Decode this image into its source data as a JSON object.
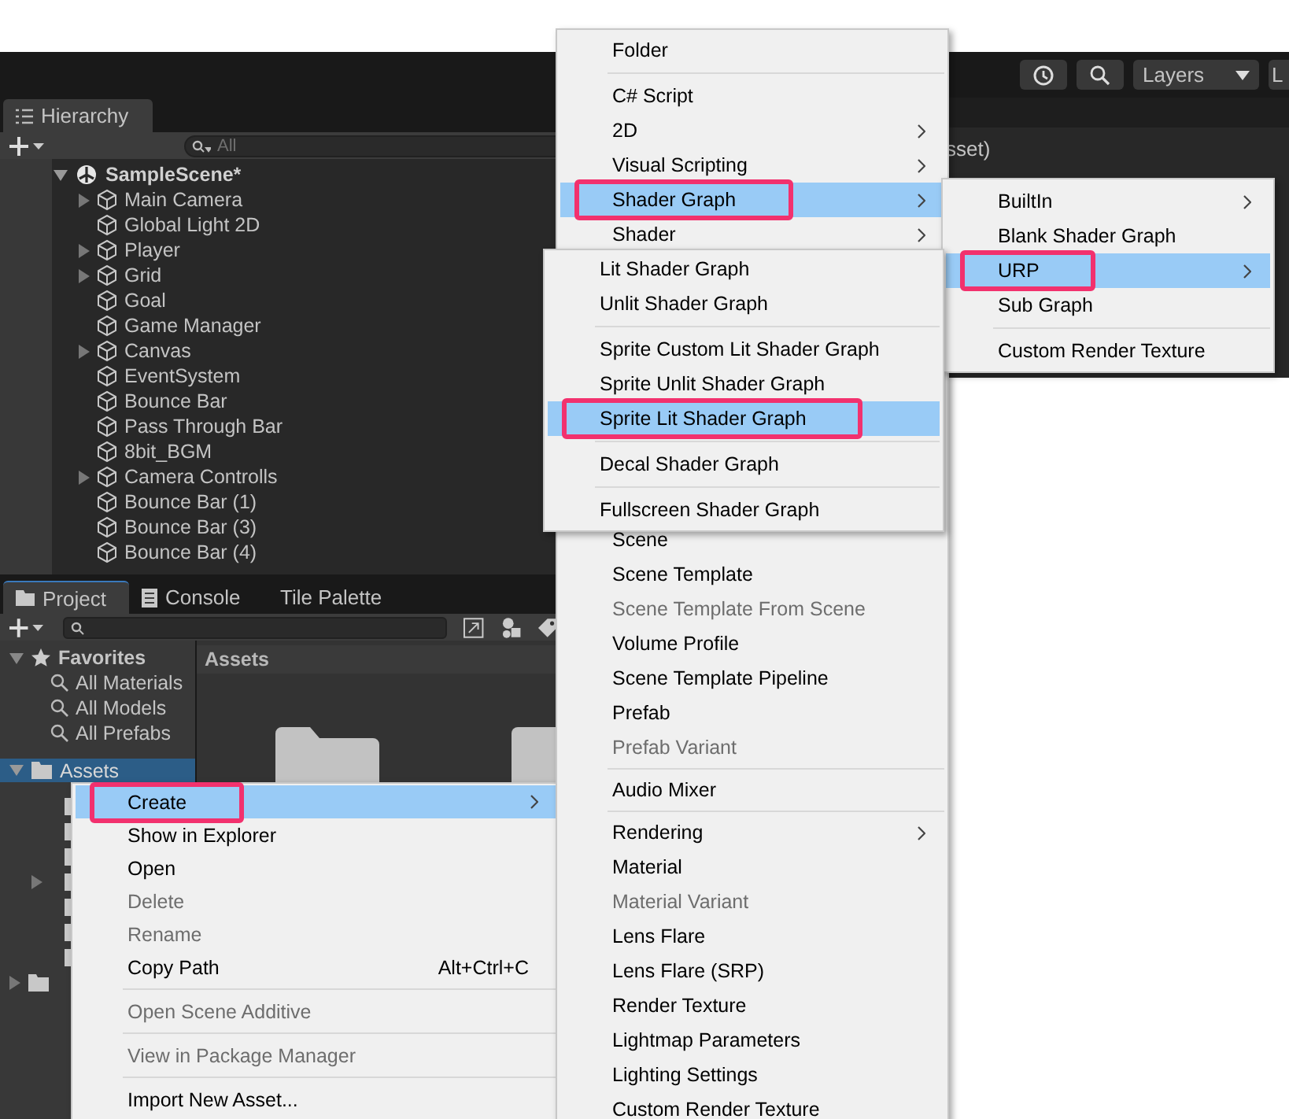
{
  "toolbar": {
    "layers_dropdown": "Layers",
    "cut_button": "L"
  },
  "hierarchy": {
    "tab": "Hierarchy",
    "search_placeholder": "All",
    "scene": {
      "label": "SampleScene*",
      "expanded": true
    },
    "items": [
      {
        "label": "Main Camera",
        "expandable": true
      },
      {
        "label": "Global Light 2D",
        "expandable": false
      },
      {
        "label": "Player",
        "expandable": true
      },
      {
        "label": "Grid",
        "expandable": true
      },
      {
        "label": "Goal",
        "expandable": false
      },
      {
        "label": "Game Manager",
        "expandable": false
      },
      {
        "label": "Canvas",
        "expandable": true
      },
      {
        "label": "EventSystem",
        "expandable": false
      },
      {
        "label": "Bounce Bar",
        "expandable": false
      },
      {
        "label": "Pass Through Bar",
        "expandable": false
      },
      {
        "label": "8bit_BGM",
        "expandable": false
      },
      {
        "label": "Camera Controlls",
        "expandable": true
      },
      {
        "label": "Bounce Bar (1)",
        "expandable": false
      },
      {
        "label": "Bounce Bar (3)",
        "expandable": false
      },
      {
        "label": "Bounce Bar (4)",
        "expandable": false
      }
    ]
  },
  "scene_view": {
    "title_fragment": "sset)"
  },
  "project": {
    "tabs": [
      {
        "label": "Project",
        "selected": true
      },
      {
        "label": "Console",
        "selected": false
      },
      {
        "label": "Tile Palette",
        "selected": false
      }
    ],
    "favorites": {
      "label": "Favorites",
      "items": [
        "All Materials",
        "All Models",
        "All Prefabs"
      ]
    },
    "assets": {
      "label": "Assets",
      "selected": true
    },
    "grid_header": "Assets"
  },
  "context_menu": {
    "items": [
      {
        "kind": "item",
        "label": "Create",
        "submenu": true,
        "selected": true,
        "disabled": false,
        "highlighted": true
      },
      {
        "kind": "item",
        "label": "Show in Explorer",
        "submenu": false,
        "selected": false,
        "disabled": false,
        "highlighted": false
      },
      {
        "kind": "item",
        "label": "Open",
        "submenu": false,
        "selected": false,
        "disabled": false,
        "highlighted": false
      },
      {
        "kind": "item",
        "label": "Delete",
        "submenu": false,
        "selected": false,
        "disabled": true,
        "highlighted": false
      },
      {
        "kind": "item",
        "label": "Rename",
        "submenu": false,
        "selected": false,
        "disabled": true,
        "highlighted": false
      },
      {
        "kind": "item",
        "label": "Copy Path",
        "shortcut": "Alt+Ctrl+C",
        "submenu": false,
        "selected": false,
        "disabled": false,
        "highlighted": false
      },
      {
        "kind": "separator"
      },
      {
        "kind": "item",
        "label": "Open Scene Additive",
        "submenu": false,
        "selected": false,
        "disabled": true,
        "highlighted": false
      },
      {
        "kind": "separator"
      },
      {
        "kind": "item",
        "label": "View in Package Manager",
        "submenu": false,
        "selected": false,
        "disabled": true,
        "highlighted": false
      },
      {
        "kind": "separator"
      },
      {
        "kind": "item",
        "label": "Import New Asset...",
        "submenu": false,
        "selected": false,
        "disabled": false,
        "highlighted": false
      }
    ]
  },
  "create_menu": {
    "items_above": [
      {
        "kind": "item",
        "label": "Folder",
        "submenu": false,
        "selected": false,
        "disabled": false,
        "highlighted": false
      },
      {
        "kind": "separator"
      },
      {
        "kind": "item",
        "label": "C# Script",
        "submenu": false,
        "selected": false,
        "disabled": false,
        "highlighted": false
      },
      {
        "kind": "item",
        "label": "2D",
        "submenu": true,
        "selected": false,
        "disabled": false,
        "highlighted": false
      },
      {
        "kind": "item",
        "label": "Visual Scripting",
        "submenu": true,
        "selected": false,
        "disabled": false,
        "highlighted": false
      },
      {
        "kind": "item",
        "label": "Shader Graph",
        "submenu": true,
        "selected": true,
        "disabled": false,
        "highlighted": true
      },
      {
        "kind": "item",
        "label": "Shader",
        "submenu": true,
        "selected": false,
        "disabled": false,
        "highlighted": false
      }
    ],
    "items_below": [
      {
        "kind": "item",
        "label": "Scene",
        "submenu": false,
        "selected": false,
        "disabled": false,
        "highlighted": false
      },
      {
        "kind": "item",
        "label": "Scene Template",
        "submenu": false,
        "selected": false,
        "disabled": false,
        "highlighted": false
      },
      {
        "kind": "item",
        "label": "Scene Template From Scene",
        "submenu": false,
        "selected": false,
        "disabled": true,
        "highlighted": false
      },
      {
        "kind": "item",
        "label": "Volume Profile",
        "submenu": false,
        "selected": false,
        "disabled": false,
        "highlighted": false
      },
      {
        "kind": "item",
        "label": "Scene Template Pipeline",
        "submenu": false,
        "selected": false,
        "disabled": false,
        "highlighted": false
      },
      {
        "kind": "item",
        "label": "Prefab",
        "submenu": false,
        "selected": false,
        "disabled": false,
        "highlighted": false
      },
      {
        "kind": "item",
        "label": "Prefab Variant",
        "submenu": false,
        "selected": false,
        "disabled": true,
        "highlighted": false
      },
      {
        "kind": "separator"
      },
      {
        "kind": "item",
        "label": "Audio Mixer",
        "submenu": false,
        "selected": false,
        "disabled": false,
        "highlighted": false
      },
      {
        "kind": "separator"
      },
      {
        "kind": "item",
        "label": "Rendering",
        "submenu": true,
        "selected": false,
        "disabled": false,
        "highlighted": false
      },
      {
        "kind": "item",
        "label": "Material",
        "submenu": false,
        "selected": false,
        "disabled": false,
        "highlighted": false
      },
      {
        "kind": "item",
        "label": "Material Variant",
        "submenu": false,
        "selected": false,
        "disabled": true,
        "highlighted": false
      },
      {
        "kind": "item",
        "label": "Lens Flare",
        "submenu": false,
        "selected": false,
        "disabled": false,
        "highlighted": false
      },
      {
        "kind": "item",
        "label": "Lens Flare (SRP)",
        "submenu": false,
        "selected": false,
        "disabled": false,
        "highlighted": false
      },
      {
        "kind": "item",
        "label": "Render Texture",
        "submenu": false,
        "selected": false,
        "disabled": false,
        "highlighted": false
      },
      {
        "kind": "item",
        "label": "Lightmap Parameters",
        "submenu": false,
        "selected": false,
        "disabled": false,
        "highlighted": false
      },
      {
        "kind": "item",
        "label": "Lighting Settings",
        "submenu": false,
        "selected": false,
        "disabled": false,
        "highlighted": false
      },
      {
        "kind": "item",
        "label": "Custom Render Texture",
        "submenu": false,
        "selected": false,
        "disabled": false,
        "highlighted": false
      }
    ]
  },
  "shader_graph_menu": {
    "items": [
      {
        "kind": "item",
        "label": "BuiltIn",
        "submenu": true,
        "selected": false,
        "disabled": false,
        "highlighted": false
      },
      {
        "kind": "item",
        "label": "Blank Shader Graph",
        "submenu": false,
        "selected": false,
        "disabled": false,
        "highlighted": false
      },
      {
        "kind": "item",
        "label": "URP",
        "submenu": true,
        "selected": true,
        "disabled": false,
        "highlighted": true
      },
      {
        "kind": "item",
        "label": "Sub Graph",
        "submenu": false,
        "selected": false,
        "disabled": false,
        "highlighted": false
      },
      {
        "kind": "separator"
      },
      {
        "kind": "item",
        "label": "Custom Render Texture",
        "submenu": false,
        "selected": false,
        "disabled": false,
        "highlighted": false
      }
    ]
  },
  "urp_menu": {
    "items": [
      {
        "kind": "item",
        "label": "Lit Shader Graph",
        "submenu": false,
        "selected": false,
        "disabled": false,
        "highlighted": false
      },
      {
        "kind": "item",
        "label": "Unlit Shader Graph",
        "submenu": false,
        "selected": false,
        "disabled": false,
        "highlighted": false
      },
      {
        "kind": "separator"
      },
      {
        "kind": "item",
        "label": "Sprite Custom Lit Shader Graph",
        "submenu": false,
        "selected": false,
        "disabled": false,
        "highlighted": false
      },
      {
        "kind": "item",
        "label": "Sprite Unlit Shader Graph",
        "submenu": false,
        "selected": false,
        "disabled": false,
        "highlighted": false
      },
      {
        "kind": "item",
        "label": "Sprite Lit Shader Graph",
        "submenu": false,
        "selected": true,
        "disabled": false,
        "highlighted": true
      },
      {
        "kind": "separator"
      },
      {
        "kind": "item",
        "label": "Decal Shader Graph",
        "submenu": false,
        "selected": false,
        "disabled": false,
        "highlighted": false
      },
      {
        "kind": "separator"
      },
      {
        "kind": "item",
        "label": "Fullscreen Shader Graph",
        "submenu": false,
        "selected": false,
        "disabled": false,
        "highlighted": false
      }
    ]
  }
}
